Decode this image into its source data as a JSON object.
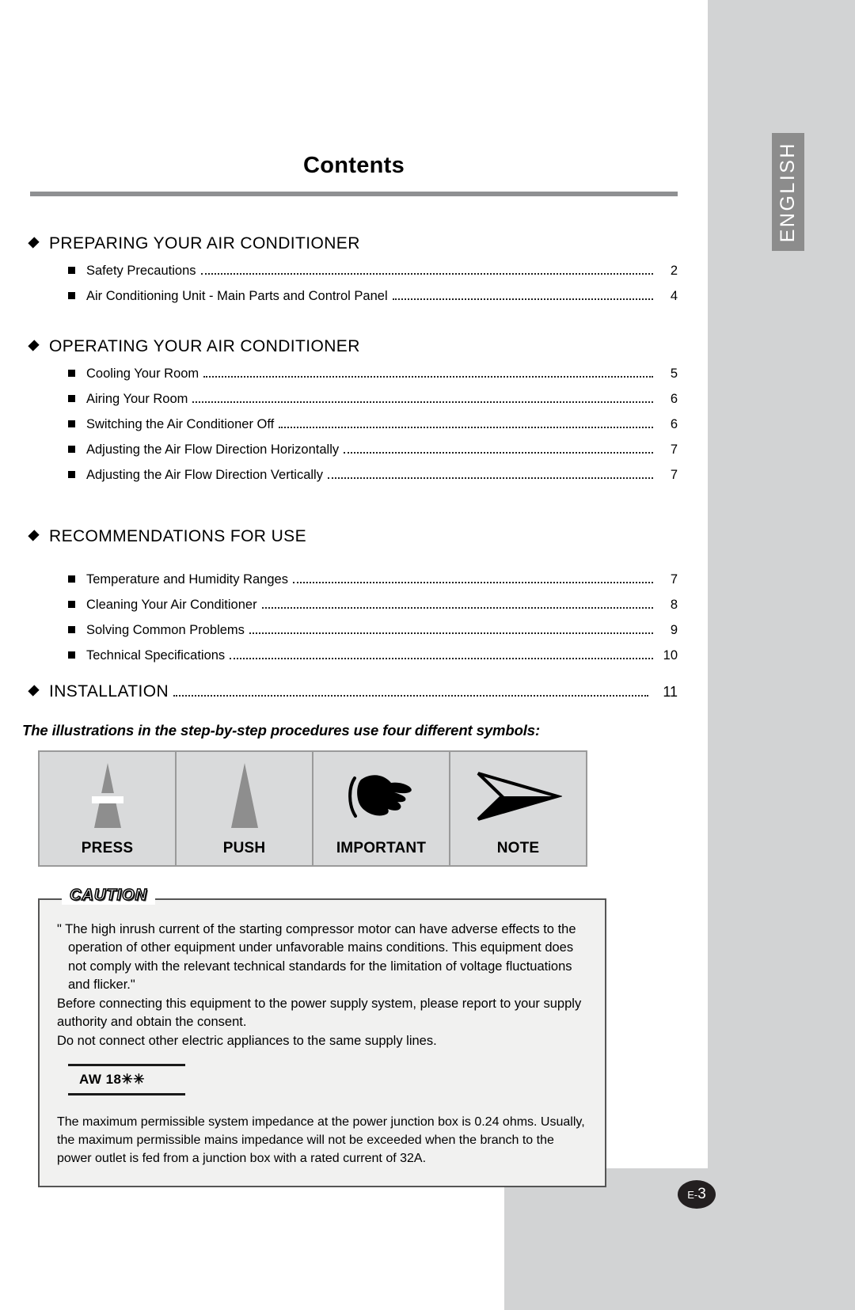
{
  "page": {
    "title": "Contents",
    "side_tab": "ENGLISH",
    "badge_prefix": "E-",
    "badge_number": "3",
    "accent_gray": "#d2d3d4",
    "rule_gray": "#8f9092",
    "tab_gray": "#8c8c8c",
    "caution_bg": "#f1f1f0"
  },
  "toc": {
    "groups": [
      {
        "title": "Preparing Your Air Conditioner",
        "entries": [
          {
            "label": "Safety Precautions",
            "page": "2"
          },
          {
            "label": "Air Conditioning Unit - Main Parts and Control Panel",
            "page": "4"
          }
        ]
      },
      {
        "title": "Operating Your Air Conditioner",
        "entries": [
          {
            "label": "Cooling Your Room",
            "page": "5"
          },
          {
            "label": "Airing Your Room",
            "page": "6"
          },
          {
            "label": "Switching the Air Conditioner Off",
            "page": "6"
          },
          {
            "label": "Adjusting the Air Flow Direction Horizontally",
            "page": "7"
          },
          {
            "label": "Adjusting the Air Flow Direction Vertically",
            "page": "7"
          }
        ]
      },
      {
        "title": "Recommendations For Use",
        "entries": [
          {
            "label": "Temperature and Humidity Ranges",
            "page": "7"
          },
          {
            "label": "Cleaning Your Air Conditioner",
            "page": "8"
          },
          {
            "label": "Solving Common Problems",
            "page": "9"
          },
          {
            "label": "Technical Specifications",
            "page": "10"
          }
        ]
      }
    ],
    "single": {
      "label": "Installation",
      "page": "11"
    }
  },
  "symbols": {
    "caption": "The illustrations in the step-by-step procedures use four different symbols:",
    "cells": [
      {
        "label": "PRESS",
        "icon": "press-triangle-icon"
      },
      {
        "label": "PUSH",
        "icon": "push-triangle-icon"
      },
      {
        "label": "IMPORTANT",
        "icon": "pointing-hand-icon"
      },
      {
        "label": "NOTE",
        "icon": "arrow-head-icon"
      }
    ]
  },
  "caution": {
    "tag": "CAUTION",
    "paragraphs": [
      "\" The high inrush current of the starting compressor motor can have adverse effects to the operation of other equipment under unfavorable mains conditions. This equipment does not comply with the relevant technical standards for the limitation of voltage fluctuations and flicker.\"",
      "Before connecting this equipment to the power supply system, please report to your supply authority and obtain the consent.",
      "Do not connect other electric appliances to the same supply lines."
    ],
    "model": "AW 18✳✳",
    "tail": "The maximum permissible system impedance at the power junction box is 0.24 ohms. Usually, the maximum permissible mains impedance will not be exceeded when the branch to the power outlet is fed from a junction box with a rated current of 32A."
  }
}
